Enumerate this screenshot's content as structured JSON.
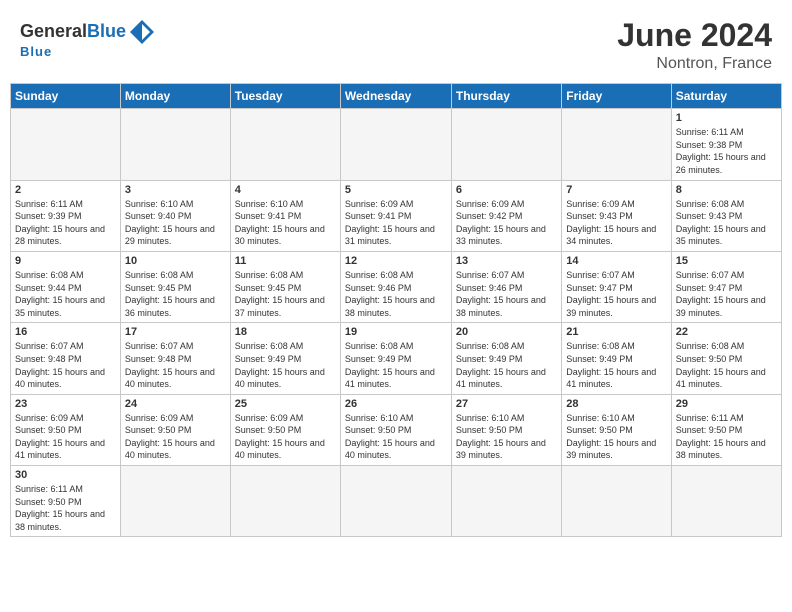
{
  "header": {
    "logo_general": "General",
    "logo_blue": "Blue",
    "month_year": "June 2024",
    "location": "Nontron, France"
  },
  "weekdays": [
    "Sunday",
    "Monday",
    "Tuesday",
    "Wednesday",
    "Thursday",
    "Friday",
    "Saturday"
  ],
  "weeks": [
    [
      {
        "day": "",
        "empty": true
      },
      {
        "day": "",
        "empty": true
      },
      {
        "day": "",
        "empty": true
      },
      {
        "day": "",
        "empty": true
      },
      {
        "day": "",
        "empty": true
      },
      {
        "day": "",
        "empty": true
      },
      {
        "day": "1",
        "sunrise": "6:11 AM",
        "sunset": "9:38 PM",
        "daylight": "15 hours and 26 minutes."
      }
    ],
    [
      {
        "day": "2",
        "sunrise": "6:11 AM",
        "sunset": "9:39 PM",
        "daylight": "15 hours and 28 minutes."
      },
      {
        "day": "3",
        "sunrise": "6:10 AM",
        "sunset": "9:40 PM",
        "daylight": "15 hours and 29 minutes."
      },
      {
        "day": "4",
        "sunrise": "6:10 AM",
        "sunset": "9:41 PM",
        "daylight": "15 hours and 30 minutes."
      },
      {
        "day": "5",
        "sunrise": "6:09 AM",
        "sunset": "9:41 PM",
        "daylight": "15 hours and 31 minutes."
      },
      {
        "day": "6",
        "sunrise": "6:09 AM",
        "sunset": "9:42 PM",
        "daylight": "15 hours and 33 minutes."
      },
      {
        "day": "7",
        "sunrise": "6:09 AM",
        "sunset": "9:43 PM",
        "daylight": "15 hours and 34 minutes."
      },
      {
        "day": "8",
        "sunrise": "6:08 AM",
        "sunset": "9:43 PM",
        "daylight": "15 hours and 35 minutes."
      }
    ],
    [
      {
        "day": "9",
        "sunrise": "6:08 AM",
        "sunset": "9:44 PM",
        "daylight": "15 hours and 35 minutes."
      },
      {
        "day": "10",
        "sunrise": "6:08 AM",
        "sunset": "9:45 PM",
        "daylight": "15 hours and 36 minutes."
      },
      {
        "day": "11",
        "sunrise": "6:08 AM",
        "sunset": "9:45 PM",
        "daylight": "15 hours and 37 minutes."
      },
      {
        "day": "12",
        "sunrise": "6:08 AM",
        "sunset": "9:46 PM",
        "daylight": "15 hours and 38 minutes."
      },
      {
        "day": "13",
        "sunrise": "6:07 AM",
        "sunset": "9:46 PM",
        "daylight": "15 hours and 38 minutes."
      },
      {
        "day": "14",
        "sunrise": "6:07 AM",
        "sunset": "9:47 PM",
        "daylight": "15 hours and 39 minutes."
      },
      {
        "day": "15",
        "sunrise": "6:07 AM",
        "sunset": "9:47 PM",
        "daylight": "15 hours and 39 minutes."
      }
    ],
    [
      {
        "day": "16",
        "sunrise": "6:07 AM",
        "sunset": "9:48 PM",
        "daylight": "15 hours and 40 minutes."
      },
      {
        "day": "17",
        "sunrise": "6:07 AM",
        "sunset": "9:48 PM",
        "daylight": "15 hours and 40 minutes."
      },
      {
        "day": "18",
        "sunrise": "6:08 AM",
        "sunset": "9:49 PM",
        "daylight": "15 hours and 40 minutes."
      },
      {
        "day": "19",
        "sunrise": "6:08 AM",
        "sunset": "9:49 PM",
        "daylight": "15 hours and 41 minutes."
      },
      {
        "day": "20",
        "sunrise": "6:08 AM",
        "sunset": "9:49 PM",
        "daylight": "15 hours and 41 minutes."
      },
      {
        "day": "21",
        "sunrise": "6:08 AM",
        "sunset": "9:49 PM",
        "daylight": "15 hours and 41 minutes."
      },
      {
        "day": "22",
        "sunrise": "6:08 AM",
        "sunset": "9:50 PM",
        "daylight": "15 hours and 41 minutes."
      }
    ],
    [
      {
        "day": "23",
        "sunrise": "6:09 AM",
        "sunset": "9:50 PM",
        "daylight": "15 hours and 41 minutes."
      },
      {
        "day": "24",
        "sunrise": "6:09 AM",
        "sunset": "9:50 PM",
        "daylight": "15 hours and 40 minutes."
      },
      {
        "day": "25",
        "sunrise": "6:09 AM",
        "sunset": "9:50 PM",
        "daylight": "15 hours and 40 minutes."
      },
      {
        "day": "26",
        "sunrise": "6:10 AM",
        "sunset": "9:50 PM",
        "daylight": "15 hours and 40 minutes."
      },
      {
        "day": "27",
        "sunrise": "6:10 AM",
        "sunset": "9:50 PM",
        "daylight": "15 hours and 39 minutes."
      },
      {
        "day": "28",
        "sunrise": "6:10 AM",
        "sunset": "9:50 PM",
        "daylight": "15 hours and 39 minutes."
      },
      {
        "day": "29",
        "sunrise": "6:11 AM",
        "sunset": "9:50 PM",
        "daylight": "15 hours and 38 minutes."
      }
    ],
    [
      {
        "day": "30",
        "sunrise": "6:11 AM",
        "sunset": "9:50 PM",
        "daylight": "15 hours and 38 minutes."
      },
      {
        "day": "",
        "empty": true
      },
      {
        "day": "",
        "empty": true
      },
      {
        "day": "",
        "empty": true
      },
      {
        "day": "",
        "empty": true
      },
      {
        "day": "",
        "empty": true
      },
      {
        "day": "",
        "empty": true
      }
    ]
  ]
}
